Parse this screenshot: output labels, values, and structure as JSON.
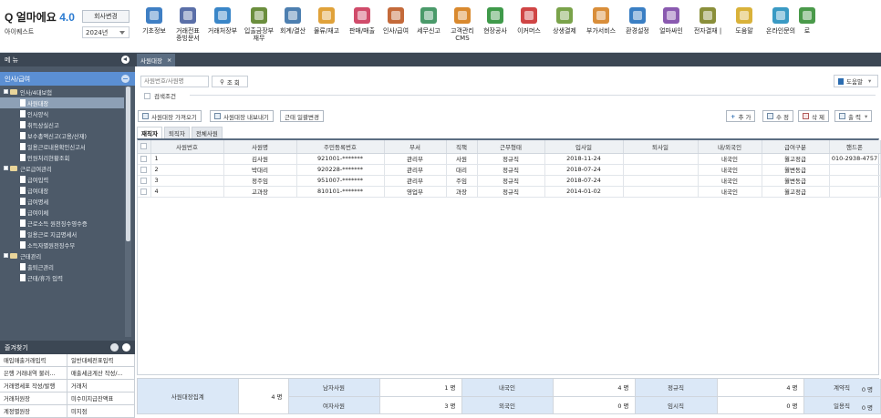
{
  "app": {
    "logo_text": "얼마에요",
    "logo_version": "4.0",
    "company_name": "아이퀘스트",
    "company_change_label": "회사변경",
    "year_value": "2024년"
  },
  "menu": [
    {
      "label": "기초정보",
      "icon": "basic-info-icon",
      "color": "#3f7fc4"
    },
    {
      "label": "거래전표\n증빙문서",
      "icon": "voucher-icon",
      "color": "#5a6fa8"
    },
    {
      "label": "거래처장부",
      "icon": "ledger-icon",
      "color": "#3a86c8"
    },
    {
      "label": "입출금장부\n재무",
      "icon": "cash-book-icon",
      "color": "#6b8e3d"
    },
    {
      "label": "회계/결산",
      "icon": "accounting-icon",
      "color": "#4d7fb0"
    },
    {
      "label": "물류/재고",
      "icon": "inventory-icon",
      "color": "#e0a23a"
    },
    {
      "label": "판매/매출",
      "icon": "sales-icon",
      "color": "#d04b6a"
    },
    {
      "label": "인사/급여",
      "icon": "hr-icon",
      "color": "#c46a3a"
    },
    {
      "label": "세무신고",
      "icon": "tax-icon",
      "color": "#4a9a6a"
    },
    {
      "label": "고객관리\nCMS",
      "icon": "crm-icon",
      "color": "#d9892e"
    },
    {
      "label": "현장공사",
      "icon": "construction-icon",
      "color": "#3f9a4a"
    },
    {
      "label": "이커머스",
      "icon": "ecommerce-icon",
      "color": "#d04545"
    },
    {
      "label": "상생결제",
      "icon": "payment-icon",
      "color": "#7aa34a"
    },
    {
      "label": "부가서비스",
      "icon": "service-icon",
      "color": "#d98e3a"
    },
    {
      "label": "환경설정",
      "icon": "settings-icon",
      "color": "#3a7fc4"
    },
    {
      "label": "얼마싸인",
      "icon": "sign-icon",
      "color": "#8a5ab0"
    },
    {
      "label": "전자결재 |",
      "icon": "approval-icon",
      "color": "#8a8f3a"
    },
    {
      "label": "도움말",
      "icon": "help-icon",
      "color": "#d9b23a"
    },
    {
      "label": "온라인문의",
      "icon": "inquiry-icon",
      "color": "#3a9ac4"
    },
    {
      "label": "로",
      "icon": "logout-icon",
      "color": "#4a9a4a"
    }
  ],
  "sidebar": {
    "title": "메 뉴",
    "group": "인사/급여",
    "tree": [
      {
        "label": "인사/4대보험",
        "type": "folder"
      },
      {
        "label": "사원대장",
        "type": "leaf",
        "selected": true
      },
      {
        "label": "인사양식",
        "type": "leaf"
      },
      {
        "label": "취득상실신고",
        "type": "leaf"
      },
      {
        "label": "보수총액신고(고용/산재)",
        "type": "leaf"
      },
      {
        "label": "일용근로내용확인신고서",
        "type": "leaf"
      },
      {
        "label": "민원처리현황조회",
        "type": "leaf"
      },
      {
        "label": "근로급여관리",
        "type": "folder"
      },
      {
        "label": "급여입력",
        "type": "leaf"
      },
      {
        "label": "급여대장",
        "type": "leaf"
      },
      {
        "label": "급여명세",
        "type": "leaf"
      },
      {
        "label": "급여이체",
        "type": "leaf"
      },
      {
        "label": "근로소득 원천징수영수증",
        "type": "leaf"
      },
      {
        "label": "일용근로 지급명세서",
        "type": "leaf"
      },
      {
        "label": "소득자별원천징수부",
        "type": "leaf"
      },
      {
        "label": "근태관리",
        "type": "folder"
      },
      {
        "label": "출퇴근관리",
        "type": "leaf"
      },
      {
        "label": "근태/휴가 입력",
        "type": "leaf"
      }
    ]
  },
  "favorites": {
    "title": "즐겨찾기",
    "items": [
      "매입매출거래입력",
      "일반대체전표입력",
      "은행 거래내역 불러...",
      "매출세금계산 작성/...",
      "거래명세표 작성/발행",
      "거래처",
      "거래처원장",
      "미수미지급잔액표",
      "계정별원장",
      "미지점"
    ]
  },
  "tabbar": {
    "tab_label": "사원대장",
    "close": "×"
  },
  "main": {
    "search_placeholder": "사원번호/사원명",
    "search_btn": "조 회",
    "help_btn": "도움말",
    "search_condition": "검색조건",
    "toolbar": [
      "사원대장 가져오기",
      "사원대장 내보내기",
      "근태 일괄변경"
    ],
    "actions": [
      "추 가",
      "수 정",
      "삭 제",
      "출 력"
    ],
    "subtabs": [
      "재직자",
      "퇴직자",
      "전체사원"
    ],
    "columns": [
      "사원번호",
      "사원명",
      "주민등록번호",
      "부서",
      "직책",
      "근무형태",
      "입사일",
      "퇴사일",
      "내/외국인",
      "급여구분",
      "핸드폰"
    ],
    "rows": [
      [
        "1",
        "김사원",
        "921001-*******",
        "관리부",
        "사원",
        "정규직",
        "2018-11-24",
        "",
        "내국인",
        "월고정급",
        "010-2938-4757"
      ],
      [
        "2",
        "박대리",
        "920228-*******",
        "관리부",
        "대리",
        "정규직",
        "2018-07-24",
        "",
        "내국인",
        "월변동급",
        ""
      ],
      [
        "3",
        "정주임",
        "951007-*******",
        "관리부",
        "주임",
        "정규직",
        "2018-07-24",
        "",
        "내국인",
        "월변동급",
        ""
      ],
      [
        "4",
        "고과장",
        "810101-*******",
        "영업부",
        "과장",
        "정규직",
        "2014-01-02",
        "",
        "내국인",
        "월고정급",
        ""
      ]
    ]
  },
  "summary": {
    "title": "사원대장집계",
    "total": "4 명",
    "male_label": "남자사원",
    "male": "1 명",
    "female_label": "여자사원",
    "female": "3 명",
    "domestic_label": "내국인",
    "domestic": "4 명",
    "foreign_label": "외국인",
    "foreign": "0 명",
    "regular_label": "정규직",
    "regular": "4 명",
    "temp_label": "임시직",
    "temp": "0 명",
    "contract_label": "계약직",
    "contract": "0 명",
    "daily_label": "일용직",
    "daily": "0 명"
  }
}
